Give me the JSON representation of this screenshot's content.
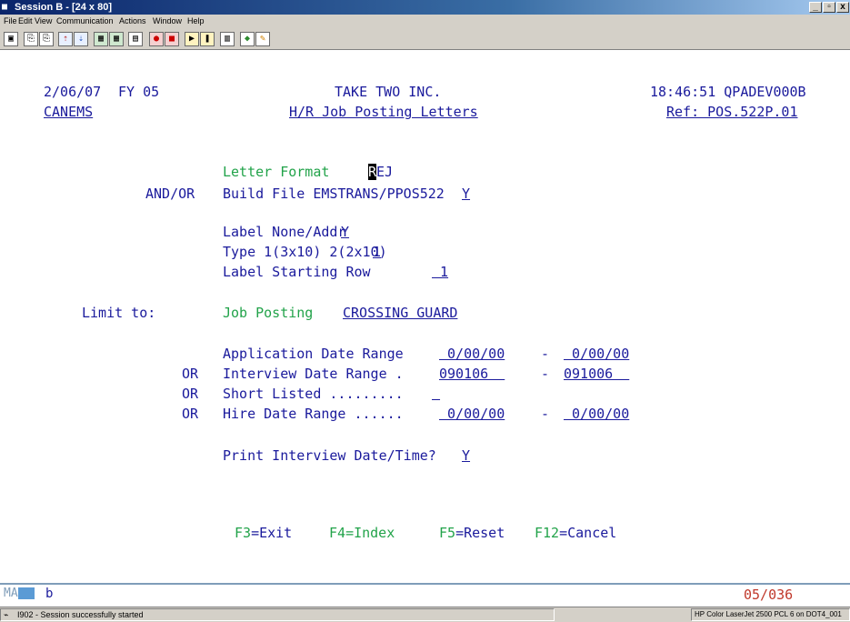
{
  "window": {
    "title": "Session B - [24 x 80]",
    "min_label": "_",
    "max_label": "▫",
    "close_label": "x"
  },
  "menu": [
    "File",
    "Edit",
    "View",
    "Communication",
    "Actions",
    "Window",
    "Help"
  ],
  "toolbar": [
    "print-screen-icon",
    "copy-icon",
    "paste-icon",
    "send-file-icon",
    "receive-file-icon",
    "display-icon",
    "keypad-icon",
    "macro-icon",
    "record-macro-icon",
    "stop-macro-icon",
    "play-macro-icon",
    "pause-macro-icon",
    "clipboard-icon",
    "color-map-icon",
    "edit-icon"
  ],
  "header": {
    "date": "2/06/07",
    "fy": "FY 05",
    "company": "TAKE TWO INC.",
    "time_system": "18:46:51 QPADEV000B",
    "user": "CANEMS",
    "screen_title": "H/R Job Posting Letters",
    "ref": "Ref: POS.522P.01"
  },
  "form": {
    "letter_format_label": "Letter Format",
    "letter_format_cursor": "R",
    "letter_format_value": "EJ",
    "andor": "AND/OR",
    "build_file_label": "Build File EMSTRANS/PPOS522",
    "build_file_value": "Y",
    "label_none_label": "Label None/Addr",
    "label_none_value": "Y",
    "type_label": "Type 1(3x10) 2(2x10)",
    "type_value": "1",
    "label_row_label": "Label Starting Row",
    "label_row_value": " 1",
    "limit_to": "Limit to:",
    "job_posting_label": "Job Posting",
    "job_posting_value": "CROSSING GUARD",
    "app_date_label": "Application Date Range",
    "app_from": " 0/00/00",
    "app_to": " 0/00/00",
    "or1": "OR",
    "interview_label": "Interview Date Range .",
    "interview_from": "090106  ",
    "interview_to": "091006  ",
    "or2": "OR",
    "short_listed_label": "Short Listed .........",
    "short_listed_value": " ",
    "or3": "OR",
    "hire_label": "Hire Date Range ......",
    "hire_from": " 0/00/00",
    "hire_to": " 0/00/00",
    "dash": "-",
    "print_label": "Print Interview Date/Time?",
    "print_value": "Y"
  },
  "fkeys": {
    "f3_key": "F3",
    "f3_text": "=Exit",
    "f4_key": "F4",
    "f4_text": "=Index",
    "f5_key": "F5",
    "f5_text": "=Reset",
    "f12_key": "F12",
    "f12_text": "=Cancel"
  },
  "oia": {
    "ma": "MA",
    "b": "b",
    "cursor_pos": "05/036"
  },
  "status": {
    "message": "I902 - Session successfully started",
    "printer": "HP Color LaserJet 2500 PCL 6 on DOT4_001"
  },
  "colors": {
    "text_blue": "#1a1a9c",
    "field_green": "#22a34a",
    "pos_red": "#c0392b"
  }
}
